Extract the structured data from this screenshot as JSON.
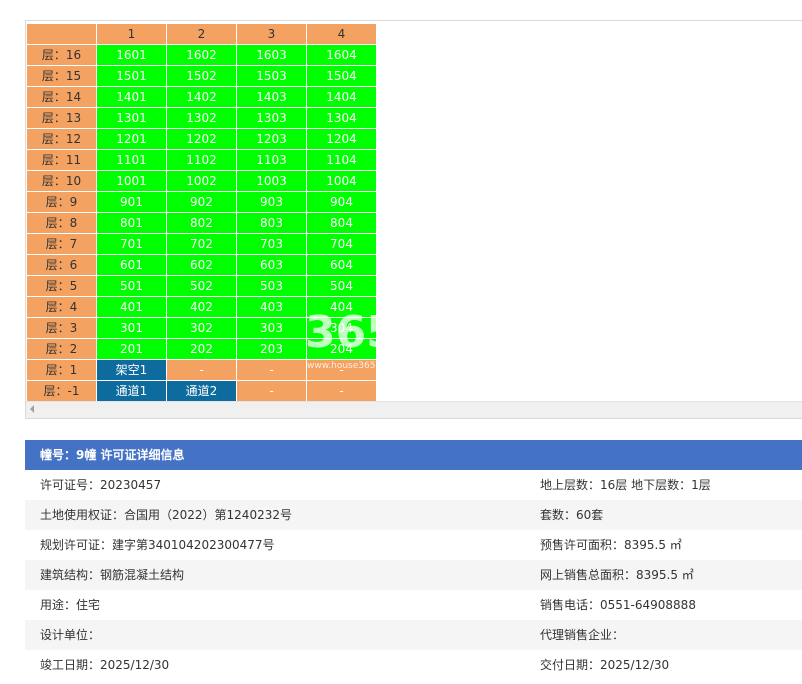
{
  "grid": {
    "column_headers": [
      "1",
      "2",
      "3",
      "4"
    ],
    "rows": [
      {
        "floor": "层：16",
        "units": [
          "1601",
          "1602",
          "1603",
          "1604"
        ],
        "status": [
          "sold",
          "sold",
          "sold",
          "sold"
        ]
      },
      {
        "floor": "层：15",
        "units": [
          "1501",
          "1502",
          "1503",
          "1504"
        ],
        "status": [
          "sold",
          "sold",
          "sold",
          "sold"
        ]
      },
      {
        "floor": "层：14",
        "units": [
          "1401",
          "1402",
          "1403",
          "1404"
        ],
        "status": [
          "sold",
          "sold",
          "sold",
          "sold"
        ]
      },
      {
        "floor": "层：13",
        "units": [
          "1301",
          "1302",
          "1303",
          "1304"
        ],
        "status": [
          "sold",
          "sold",
          "sold",
          "sold"
        ]
      },
      {
        "floor": "层：12",
        "units": [
          "1201",
          "1202",
          "1203",
          "1204"
        ],
        "status": [
          "sold",
          "sold",
          "sold",
          "sold"
        ]
      },
      {
        "floor": "层：11",
        "units": [
          "1101",
          "1102",
          "1103",
          "1104"
        ],
        "status": [
          "sold",
          "sold",
          "sold",
          "sold"
        ]
      },
      {
        "floor": "层：10",
        "units": [
          "1001",
          "1002",
          "1003",
          "1004"
        ],
        "status": [
          "sold",
          "sold",
          "sold",
          "sold"
        ]
      },
      {
        "floor": "层：9",
        "units": [
          "901",
          "902",
          "903",
          "904"
        ],
        "status": [
          "sold",
          "sold",
          "sold",
          "sold"
        ]
      },
      {
        "floor": "层：8",
        "units": [
          "801",
          "802",
          "803",
          "804"
        ],
        "status": [
          "sold",
          "sold",
          "sold",
          "sold"
        ]
      },
      {
        "floor": "层：7",
        "units": [
          "701",
          "702",
          "703",
          "704"
        ],
        "status": [
          "sold",
          "sold",
          "sold",
          "sold"
        ]
      },
      {
        "floor": "层：6",
        "units": [
          "601",
          "602",
          "603",
          "604"
        ],
        "status": [
          "sold",
          "sold",
          "sold",
          "sold"
        ]
      },
      {
        "floor": "层：5",
        "units": [
          "501",
          "502",
          "503",
          "504"
        ],
        "status": [
          "sold",
          "sold",
          "sold",
          "sold"
        ]
      },
      {
        "floor": "层：4",
        "units": [
          "401",
          "402",
          "403",
          "404"
        ],
        "status": [
          "sold",
          "sold",
          "sold",
          "sold"
        ]
      },
      {
        "floor": "层：3",
        "units": [
          "301",
          "302",
          "303",
          "304"
        ],
        "status": [
          "sold",
          "sold",
          "sold",
          "sold"
        ]
      },
      {
        "floor": "层：2",
        "units": [
          "201",
          "202",
          "203",
          "204"
        ],
        "status": [
          "sold",
          "sold",
          "sold",
          "sold"
        ]
      },
      {
        "floor": "层：1",
        "units": [
          "架空1",
          "-",
          "-",
          "-"
        ],
        "status": [
          "blue",
          "empty",
          "empty",
          "empty"
        ]
      },
      {
        "floor": "层：-1",
        "units": [
          "通道1",
          "通道2",
          "-",
          "-"
        ],
        "status": [
          "blue",
          "blue",
          "empty",
          "empty"
        ]
      }
    ],
    "colors": {
      "header": "#f4a261",
      "sold": "#00ff00",
      "special": "#0e6b9e"
    }
  },
  "watermark": {
    "text": "365",
    "subtext": "www.house365"
  },
  "detail": {
    "title": "幢号：9幢 许可证详细信息",
    "rows": [
      {
        "left": "许可证号：20230457",
        "right": "地上层数：16层  地下层数：1层"
      },
      {
        "left": "土地使用权证：合国用（2022）第1240232号",
        "right": "套数：60套"
      },
      {
        "left": "规划许可证：建字第340104202300477号",
        "right": "预售许可面积：8395.5 ㎡"
      },
      {
        "left": "建筑结构：钢筋混凝土结构",
        "right": "网上销售总面积：8395.5 ㎡"
      },
      {
        "left": "用途：住宅",
        "right": "销售电话：0551-64908888"
      },
      {
        "left": "设计单位：",
        "right": "代理销售企业："
      },
      {
        "left": "竣工日期：2025/12/30",
        "right": "交付日期：2025/12/30"
      }
    ]
  }
}
